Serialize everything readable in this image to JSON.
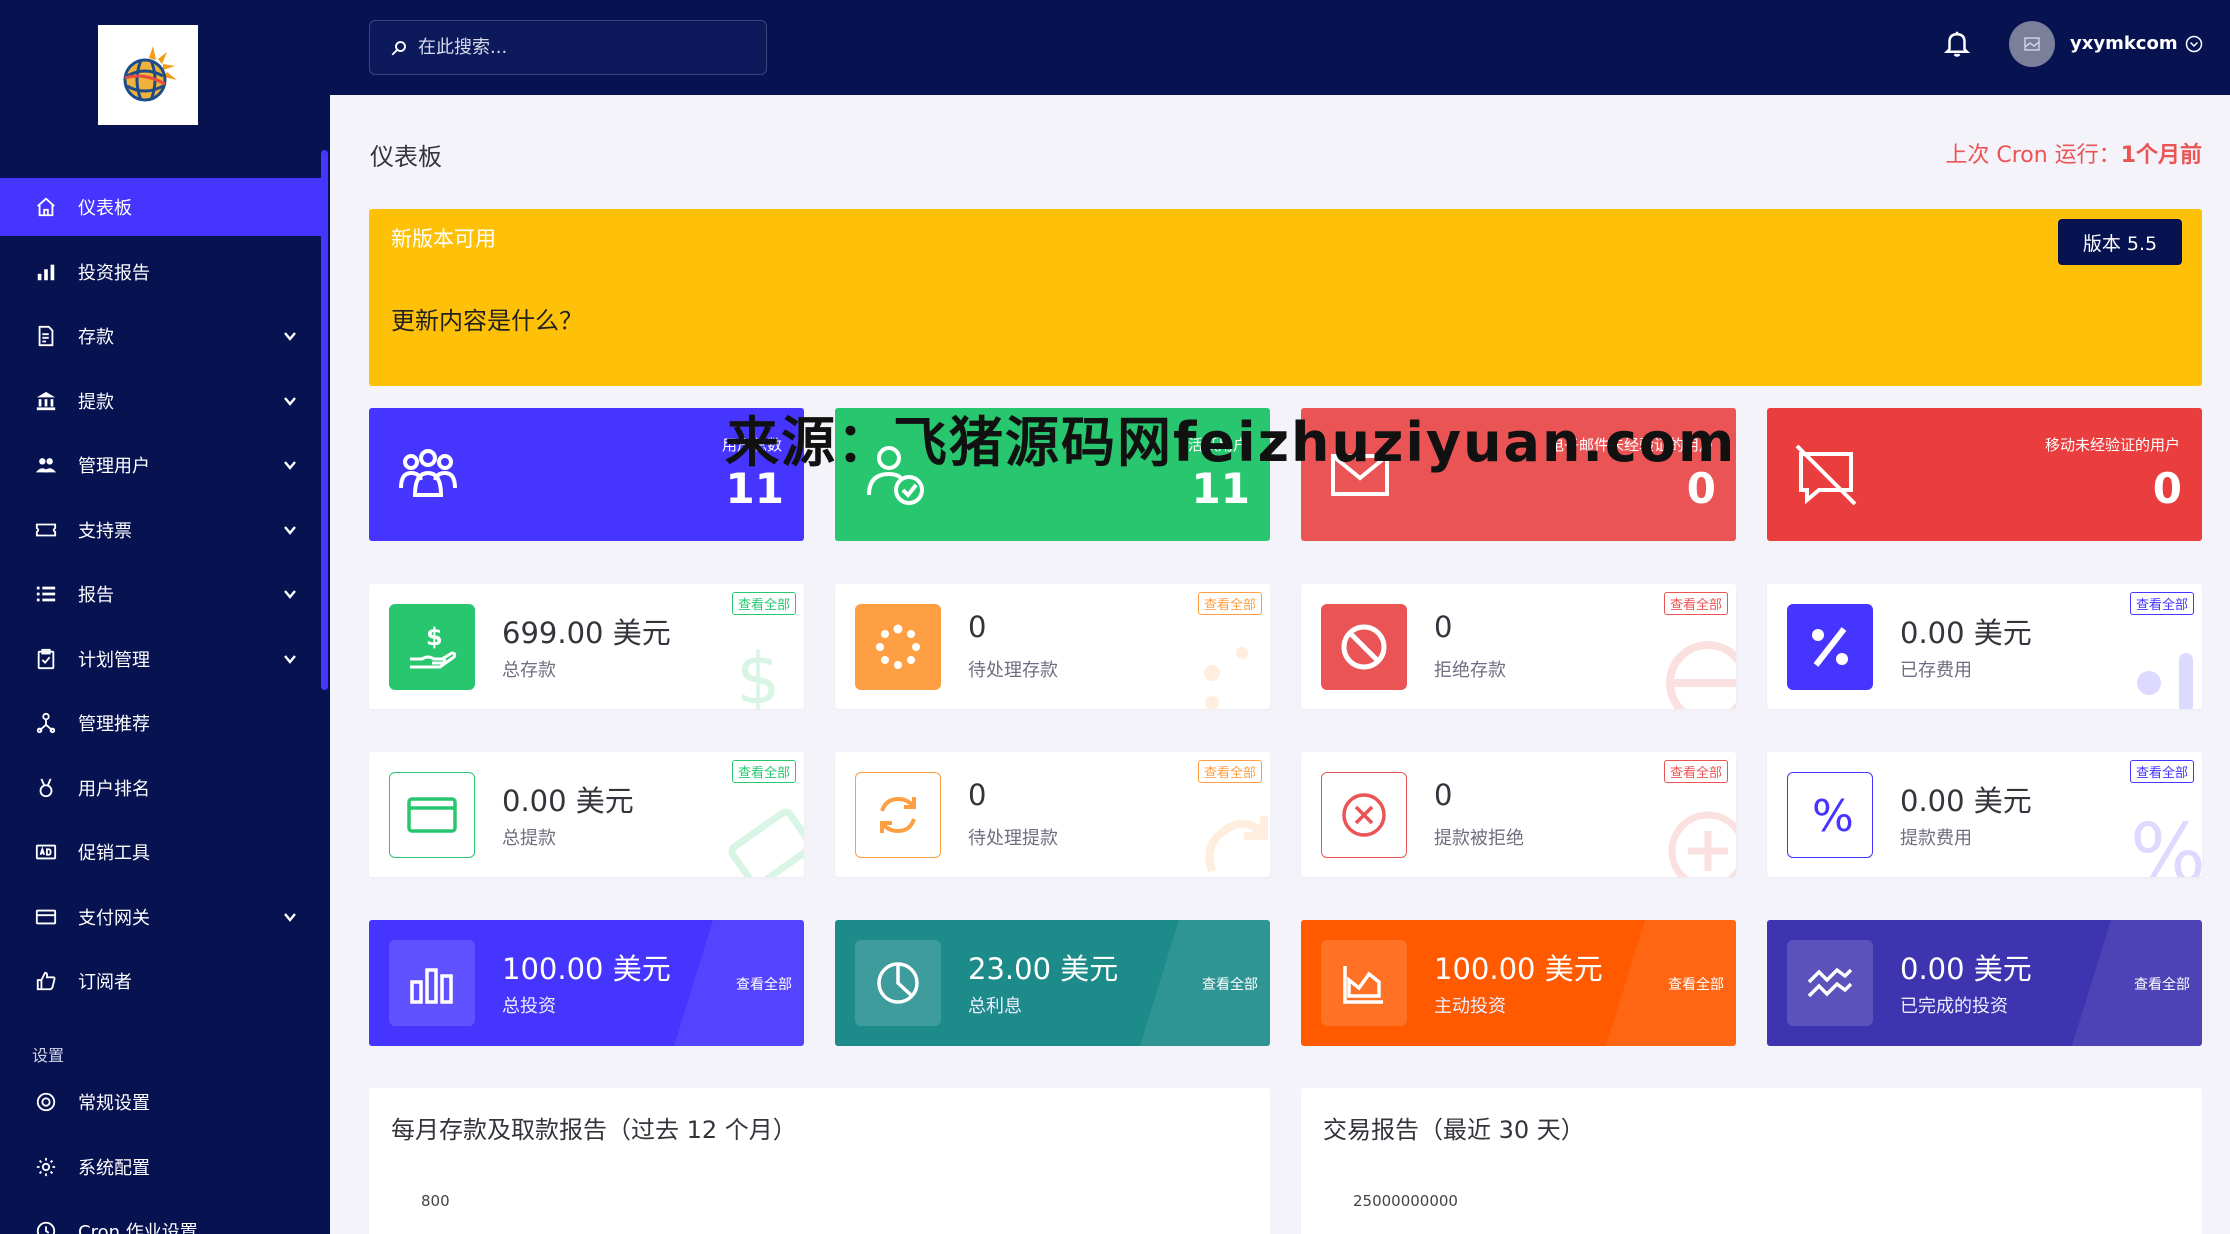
{
  "topbar": {
    "search_placeholder": "在此搜索...",
    "username": "yxymkcom"
  },
  "sidebar": {
    "items": [
      {
        "label": "仪表板",
        "icon": "home-icon",
        "active": true,
        "has_caret": false
      },
      {
        "label": "投资报告",
        "icon": "bar-chart-icon",
        "active": false,
        "has_caret": false
      },
      {
        "label": "存款",
        "icon": "deposit-icon",
        "active": false,
        "has_caret": true
      },
      {
        "label": "提款",
        "icon": "bank-icon",
        "active": false,
        "has_caret": true
      },
      {
        "label": "管理用户",
        "icon": "users-icon",
        "active": false,
        "has_caret": true
      },
      {
        "label": "支持票",
        "icon": "ticket-icon",
        "active": false,
        "has_caret": true
      },
      {
        "label": "报告",
        "icon": "list-icon",
        "active": false,
        "has_caret": true
      },
      {
        "label": "计划管理",
        "icon": "clipboard-icon",
        "active": false,
        "has_caret": true
      },
      {
        "label": "管理推荐",
        "icon": "tree-icon",
        "active": false,
        "has_caret": false
      },
      {
        "label": "用户排名",
        "icon": "medal-icon",
        "active": false,
        "has_caret": false
      },
      {
        "label": "促销工具",
        "icon": "ad-icon",
        "active": false,
        "has_caret": false
      },
      {
        "label": "支付网关",
        "icon": "credit-card-icon",
        "active": false,
        "has_caret": true
      },
      {
        "label": "订阅者",
        "icon": "thumbs-up-icon",
        "active": false,
        "has_caret": false
      }
    ],
    "section_settings": "设置",
    "settings_items": [
      {
        "label": "常规设置",
        "icon": "life-ring-icon"
      },
      {
        "label": "系统配置",
        "icon": "gear-icon"
      },
      {
        "label": "Cron 作业设置",
        "icon": "clock-icon"
      }
    ]
  },
  "page": {
    "title": "仪表板",
    "cron_prefix": "上次 Cron 运行：",
    "cron_value": "1个月前"
  },
  "banner": {
    "title": "新版本可用",
    "subtitle": "更新内容是什么？",
    "version": "版本 5.5"
  },
  "top_cards": [
    {
      "label": "用户总数",
      "value": "11",
      "color": "#4634ff",
      "icon": "users-group-icon"
    },
    {
      "label": "活跃用户",
      "value": "11",
      "color": "#28c76f",
      "icon": "user-check-icon"
    },
    {
      "label": "电子邮件未经验证的用户",
      "value": "0",
      "color": "#eb2222",
      "icon": "envelope-icon"
    },
    {
      "label": "移动未经验证的用户",
      "value": "0",
      "color": "#ea3e3e",
      "icon": "comment-slash-icon"
    }
  ],
  "badge_label": "查看全部",
  "stat_row1": [
    {
      "value": "699.00 美元",
      "label": "总存款",
      "color": "#28c76f",
      "icon": "hand-dollar-icon",
      "filled": true
    },
    {
      "value": "0",
      "label": "待处理存款",
      "color": "#ff9f43",
      "icon": "spinner-icon",
      "filled": true
    },
    {
      "value": "0",
      "label": "拒绝存款",
      "color": "#ea5455",
      "icon": "ban-icon",
      "filled": true
    },
    {
      "value": "0.00 美元",
      "label": "已存费用",
      "color": "#4634ff",
      "icon": "percent-icon",
      "filled": true
    }
  ],
  "stat_row2": [
    {
      "value": "0.00 美元",
      "label": "总提款",
      "color": "#28c76f",
      "icon": "credit-card-outline-icon",
      "filled": false
    },
    {
      "value": "0",
      "label": "待处理提款",
      "color": "#ff9f43",
      "icon": "sync-icon",
      "filled": false
    },
    {
      "value": "0",
      "label": "提款被拒绝",
      "color": "#ea5455",
      "icon": "times-circle-icon",
      "filled": false
    },
    {
      "value": "0.00 美元",
      "label": "提款费用",
      "color": "#4634ff",
      "icon": "percent-outline-icon",
      "filled": false
    }
  ],
  "invest_cards": [
    {
      "value": "100.00 美元",
      "label": "总投资",
      "color": "#4634ff",
      "icon": "chart-bars-icon"
    },
    {
      "value": "23.00 美元",
      "label": "总利息",
      "color": "#1e8b8b",
      "icon": "pie-chart-icon"
    },
    {
      "value": "100.00 美元",
      "label": "主动投资",
      "color": "#ff5a00",
      "icon": "chart-area-icon"
    },
    {
      "value": "0.00 美元",
      "label": "已完成的投资",
      "color": "#3f34b0",
      "icon": "chart-wave-icon"
    }
  ],
  "panels": [
    {
      "title": "每月存款及取款报告（过去 12 个月）",
      "axis_top": "800"
    },
    {
      "title": "交易报告（最近 30 天）",
      "axis_top": "25000000000"
    }
  ],
  "watermark": "来源：飞猪源码网feizhuziyuan.com"
}
